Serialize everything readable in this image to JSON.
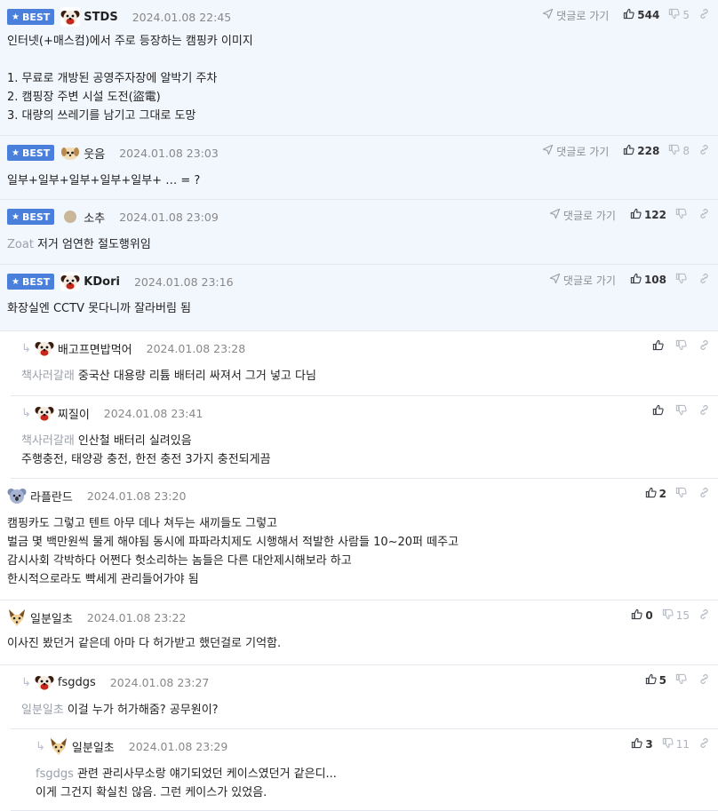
{
  "ui": {
    "best_label": "BEST",
    "goto_label": "댓글로 가기"
  },
  "comments": [
    {
      "nick": "STDS",
      "date": "2024.01.08 22:45",
      "best": true,
      "up": "544",
      "down": "5",
      "lines": [
        "인터넷(+매스컴)에서 주로 등장하는 캠핑카 이미지",
        "",
        "1. 무료로 개방된 공영주자장에 알박기 주차",
        "2. 캠핑장 주변 시설 도전(盜電)",
        "3. 대량의 쓰레기를 남기고 그대로 도망"
      ]
    },
    {
      "nick": "웃음",
      "date": "2024.01.08 23:03",
      "best": true,
      "up": "228",
      "down": "8",
      "lines": [
        "일부+일부+일부+일부+일부+ … = ?"
      ]
    },
    {
      "nick": "소추",
      "date": "2024.01.08 23:09",
      "best": true,
      "up": "122",
      "down": "",
      "mention": "Zoat",
      "lines": [
        "저거 엄연한 절도행위임"
      ]
    },
    {
      "nick": "KDori",
      "date": "2024.01.08 23:16",
      "best": true,
      "up": "108",
      "down": "",
      "lines": [
        "화장실엔 CCTV 못다니까 잘라버림 됨"
      ]
    },
    {
      "nick": "배고프면밥먹어",
      "date": "2024.01.08 23:28",
      "best": false,
      "up": "",
      "down": "",
      "mention": "책사러갈래",
      "lines": [
        "중국산 대용량 리튬 배터리 싸져서 그거 넣고 다님"
      ]
    },
    {
      "nick": "찌질이",
      "date": "2024.01.08 23:41",
      "best": false,
      "up": "",
      "down": "",
      "mention": "책사러갈래",
      "lines": [
        "인산철 배터리 실려있음",
        "주행충전, 태양광 충전, 한전 충전 3가지 충전되게끔"
      ]
    },
    {
      "nick": "라플란드",
      "date": "2024.01.08 23:20",
      "best": false,
      "up": "2",
      "down": "",
      "lines": [
        "캠핑카도 그렇고 텐트 아무 데나 쳐두는 새끼들도 그렇고",
        "벌금 몇 백만원씩 물게 해야됨 동시에 파파라치제도 시행해서 적발한 사람들 10~20퍼 떼주고",
        "감시사회 각박하다 어쩐다 헛소리하는 놈들은 다른 대안제시해보라 하고",
        "한시적으로라도 빡세게 관리들어가야 됨"
      ]
    },
    {
      "nick": "일분일초",
      "date": "2024.01.08 23:22",
      "best": false,
      "up": "0",
      "down": "15",
      "lines": [
        "이사진 봤던거 같은데 아마 다 허가받고 했던걸로 기억함."
      ]
    },
    {
      "nick": "fsgdgs",
      "date": "2024.01.08 23:27",
      "best": false,
      "up": "5",
      "down": "",
      "mention": "일분일초",
      "lines": [
        "이걸 누가 허가해줌? 공무원이?"
      ]
    },
    {
      "nick": "일분일초",
      "date": "2024.01.08 23:29",
      "best": false,
      "up": "3",
      "down": "11",
      "mention": "fsgdgs",
      "lines": [
        "관련 관리사무소랑 얘기되었던 케이스였던거 같은디...",
        "이게 그건지 확실친 않음. 그런 케이스가 있었음."
      ]
    }
  ],
  "icons": {
    "avatar": [
      "dog-avatar-icon",
      "puppy-avatar-icon",
      "circle-avatar-icon",
      "dog-avatar-icon",
      "dog-avatar-icon",
      "dog-avatar-icon",
      "koala-avatar-icon",
      "fox-avatar-icon",
      "dog-avatar-icon",
      "fox-avatar-icon"
    ]
  },
  "colors": {
    "best_bg": "#f2f6fd",
    "badge": "#4a7fdb"
  }
}
